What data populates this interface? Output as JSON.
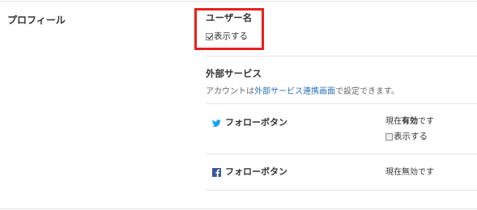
{
  "profile": {
    "section_title": "プロフィール",
    "username": {
      "title": "ユーザー名",
      "display_label": "表示する",
      "display_checked": true
    }
  },
  "external_services": {
    "title": "外部サービス",
    "desc_before": "アカウントは",
    "desc_link": "外部サービス連携画面",
    "desc_after": "で設定できます。",
    "twitter": {
      "icon": "twitter-bird-icon",
      "label": "フォローボタン",
      "status_prefix": "現在",
      "status_value": "有効",
      "status_suffix": "です",
      "display_label": "表示する",
      "display_checked": false
    },
    "facebook": {
      "icon": "facebook-icon",
      "label": "フォローボタン",
      "status": "現在無効です"
    }
  },
  "colors": {
    "highlight": "#e8201e",
    "link": "#2a6fb7",
    "twitter": "#1da1f2",
    "facebook": "#3b5998"
  }
}
